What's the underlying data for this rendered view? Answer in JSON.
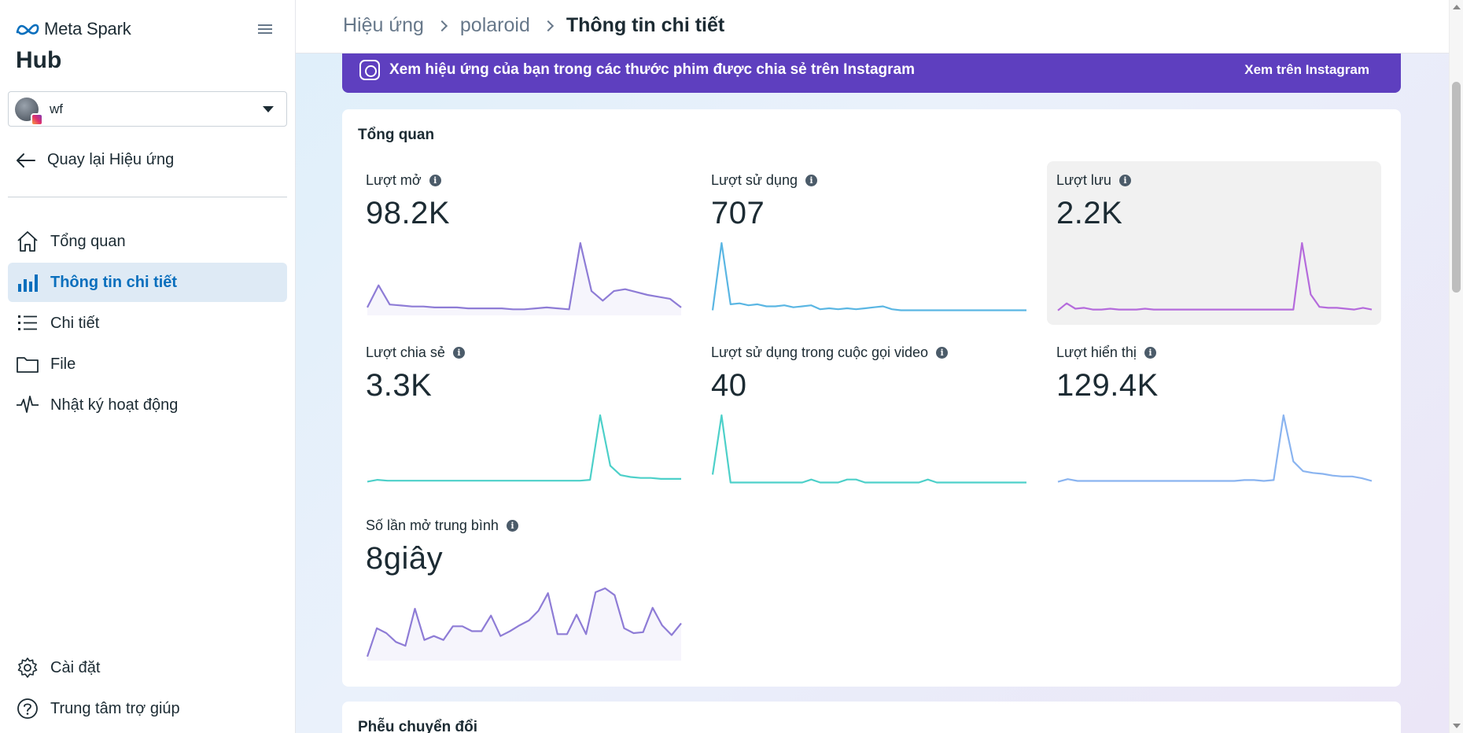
{
  "sidebar": {
    "brand": "Meta Spark",
    "hub_title": "Hub",
    "account": {
      "name": "wf"
    },
    "back_label": "Quay lại Hiệu ứng",
    "items": [
      {
        "label": "Tổng quan",
        "icon": "home-icon"
      },
      {
        "label": "Thông tin chi tiết",
        "icon": "bar-chart-icon",
        "active": true
      },
      {
        "label": "Chi tiết",
        "icon": "list-icon"
      },
      {
        "label": "File",
        "icon": "folder-icon"
      },
      {
        "label": "Nhật ký hoạt động",
        "icon": "activity-icon"
      }
    ],
    "bottom_items": [
      {
        "label": "Cài đặt",
        "icon": "gear-icon"
      },
      {
        "label": "Trung tâm trợ giúp",
        "icon": "help-icon"
      }
    ]
  },
  "breadcrumb": [
    "Hiệu ứng",
    "polaroid",
    "Thông tin chi tiết"
  ],
  "banner": {
    "text": "Xem hiệu ứng của bạn trong các thước phim được chia sẻ trên Instagram",
    "link": "Xem trên Instagram",
    "color": "#5e3fbf"
  },
  "overview": {
    "title": "Tổng quan",
    "metrics": [
      {
        "label": "Lượt mở",
        "value": "98.2K",
        "color": "#8e7cd6",
        "fill": true,
        "series": [
          5,
          28,
          8,
          7,
          6,
          6,
          5,
          5,
          5,
          4,
          4,
          4,
          4,
          3,
          3,
          4,
          5,
          4,
          3,
          72,
          22,
          12,
          22,
          24,
          21,
          18,
          16,
          14,
          5
        ]
      },
      {
        "label": "Lượt sử dụng",
        "value": "707",
        "color": "#5ab6e3",
        "fill": false,
        "series": [
          2,
          70,
          8,
          9,
          7,
          8,
          6,
          6,
          7,
          5,
          6,
          7,
          3,
          4,
          3,
          4,
          3,
          4,
          5,
          6,
          3,
          2,
          2,
          2,
          2,
          2,
          2,
          2,
          2,
          2,
          2,
          2,
          2,
          2,
          2,
          2
        ]
      },
      {
        "label": "Lượt lưu",
        "value": "2.2K",
        "color": "#b56bdc",
        "fill": false,
        "highlight": true,
        "series": [
          2,
          10,
          4,
          5,
          3,
          3,
          4,
          3,
          3,
          3,
          4,
          3,
          3,
          3,
          3,
          3,
          3,
          3,
          3,
          3,
          3,
          3,
          3,
          3,
          3,
          3,
          3,
          3,
          78,
          20,
          6,
          5,
          5,
          4,
          3,
          5,
          3
        ]
      },
      {
        "label": "Lượt chia sẻ",
        "value": "3.3K",
        "color": "#4dd0c9",
        "fill": false,
        "series": [
          3,
          5,
          4,
          4,
          4,
          4,
          4,
          4,
          4,
          4,
          4,
          4,
          4,
          4,
          4,
          4,
          4,
          4,
          4,
          4,
          4,
          4,
          5,
          74,
          20,
          10,
          8,
          7,
          7,
          6,
          6,
          6
        ]
      },
      {
        "label": "Lượt sử dụng trong cuộc gọi video",
        "value": "40",
        "color": "#4dd0c9",
        "fill": false,
        "series": [
          10,
          70,
          2,
          2,
          2,
          2,
          2,
          2,
          2,
          2,
          2,
          5,
          2,
          2,
          2,
          5,
          5,
          2,
          2,
          2,
          2,
          2,
          2,
          2,
          5,
          2,
          2,
          2,
          2,
          2,
          2,
          2,
          2,
          2,
          2,
          2
        ]
      },
      {
        "label": "Lượt hiển thị",
        "value": "129.4K",
        "color": "#8ab4f0",
        "fill": false,
        "series": [
          3,
          6,
          4,
          4,
          4,
          4,
          4,
          4,
          4,
          4,
          4,
          4,
          4,
          4,
          4,
          4,
          4,
          4,
          4,
          5,
          5,
          4,
          5,
          78,
          26,
          15,
          13,
          12,
          10,
          9,
          9,
          7,
          4
        ]
      },
      {
        "label": "Số lần mở trung bình",
        "value": "8giây",
        "color": "#8e7cd6",
        "fill": true,
        "series": [
          1,
          30,
          25,
          16,
          12,
          50,
          18,
          22,
          18,
          32,
          32,
          27,
          27,
          43,
          22,
          27,
          33,
          38,
          48,
          66,
          24,
          24,
          44,
          24,
          67,
          71,
          64,
          30,
          25,
          26,
          51,
          33,
          23,
          35
        ]
      }
    ]
  },
  "next_section_title": "Phễu chuyển đổi"
}
